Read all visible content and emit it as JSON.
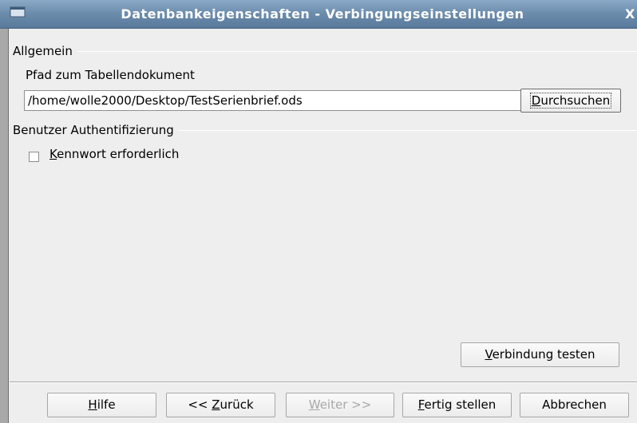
{
  "window": {
    "title": "Datenbankeigenschaften - Verbingungseinstellungen"
  },
  "groups": {
    "general": {
      "label": "Allgemein",
      "path_label": "Pfad zum Tabellendokument",
      "path_value": "/home/wolle2000/Desktop/TestSerienbrief.ods",
      "browse_label_mnemonic": "D",
      "browse_label_rest": "urchsuchen"
    },
    "auth": {
      "label": "Benutzer Authentifizierung",
      "password_required_mnemonic": "K",
      "password_required_rest": "ennwort erforderlich",
      "password_required_checked": false
    }
  },
  "actions": {
    "test_connection_mnemonic": "V",
    "test_connection_rest": "erbindung testen"
  },
  "footer": {
    "help_mnemonic": "H",
    "help_rest": "ilfe",
    "back_prefix": "<< ",
    "back_mnemonic": "Z",
    "back_rest": "urück",
    "next_mnemonic": "W",
    "next_rest": "eiter >>",
    "next_enabled": false,
    "finish_mnemonic": "F",
    "finish_rest": "ertig stellen",
    "cancel_label": "Abbrechen"
  },
  "icons": {
    "window_menu": "window-menu-icon",
    "close": "close-icon",
    "checkbox": "checkbox"
  },
  "colors": {
    "titlebar": "#6b8bab",
    "background": "#eeeeee",
    "disabled_text": "#a8a8a8"
  }
}
